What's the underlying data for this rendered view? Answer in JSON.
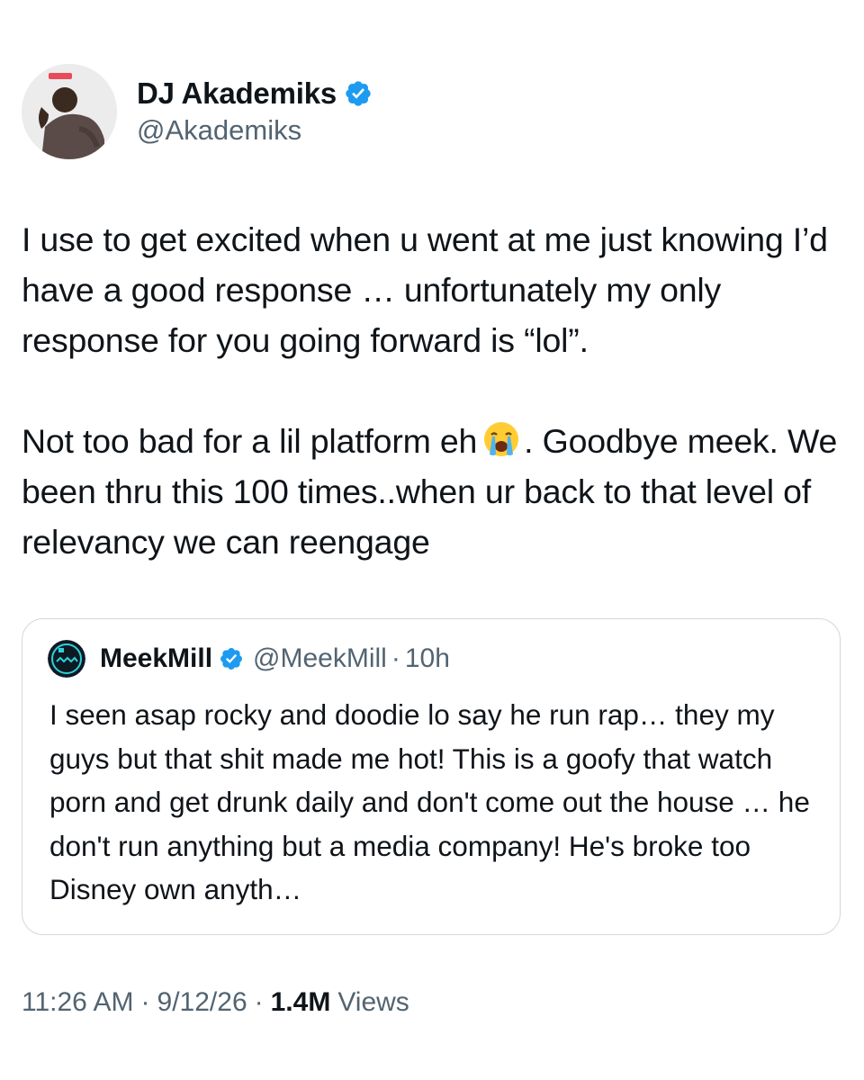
{
  "tweet": {
    "author": {
      "display_name": "DJ Akademiks",
      "handle": "@Akademiks",
      "verified": true,
      "avatar_icon": "profile-photo"
    },
    "text_paragraph_1": "I use to get excited when u went at me just knowing I’d have a good response … unfortunately my only response for you going forward is “lol”.",
    "text_paragraph_2_before_emoji": "Not too bad for a lil platform eh",
    "emoji_icon": "loudly-crying-face-emoji",
    "text_paragraph_2_after_emoji": ". Goodbye meek. We been thru this 100 times..when ur back to that level of relevancy we can reengage",
    "time": "11:26 AM",
    "date": "9/12/26",
    "views_count": "1.4M",
    "views_label": "Views",
    "separator": "·"
  },
  "quoted_tweet": {
    "display_name": "MeekMill",
    "handle": "@MeekMill",
    "separator": "·",
    "time_ago": "10h",
    "verified": true,
    "text": "I seen asap rocky and doodie lo say he run rap… they my guys but that shit made me hot! This is a goofy that watch porn and get drunk daily and don't come out the house … he don't run anything but a media company! He's broke too Disney own anyth…"
  },
  "colors": {
    "primary_text": "#0f1419",
    "secondary_text": "#536471",
    "verified_badge": "#1d9bf0",
    "card_border": "#cfd9de",
    "background": "#ffffff"
  }
}
